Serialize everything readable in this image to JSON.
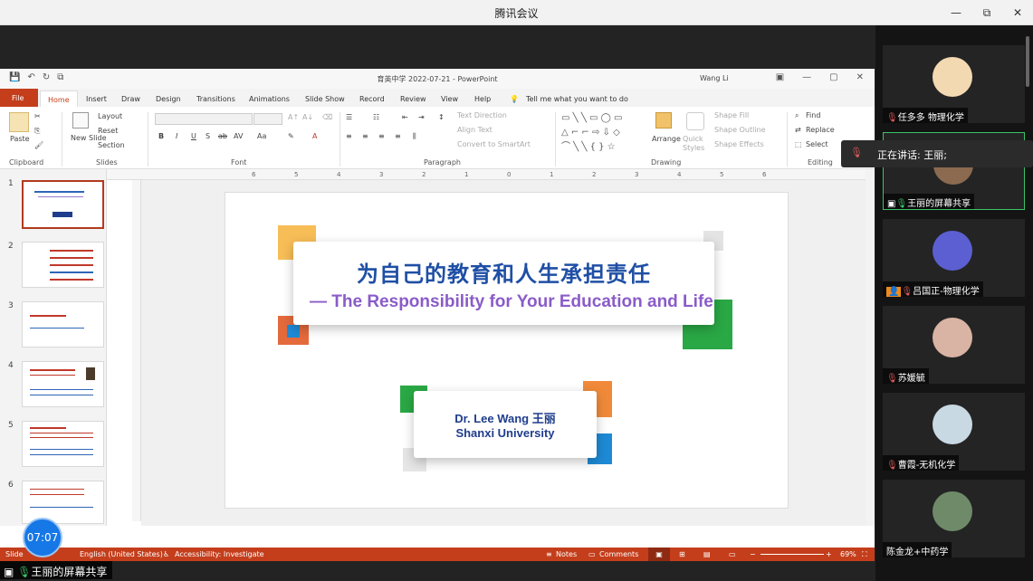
{
  "app_title": "腾讯会议",
  "window_controls": [
    "—",
    "▢",
    "⧉",
    "✕"
  ],
  "ppt": {
    "doc_title": "育英中学 2022-07-21 - PowerPoint",
    "user": "Wang Li",
    "tabs": [
      "File",
      "Home",
      "Insert",
      "Draw",
      "Design",
      "Transitions",
      "Animations",
      "Slide Show",
      "Record",
      "Review",
      "View",
      "Help"
    ],
    "tellme": "Tell me what you want to do",
    "ribbon": {
      "paste": "Paste",
      "new_slide": "New Slide",
      "layout": "Layout",
      "reset": "Reset",
      "section": "Section",
      "text_direction": "Text Direction",
      "align_text": "Align Text",
      "convert_smartart": "Convert to SmartArt",
      "arrange": "Arrange",
      "quick_styles": "Quick Styles",
      "shape_fill": "Shape Fill",
      "shape_outline": "Shape Outline",
      "shape_effects": "Shape Effects",
      "find": "Find",
      "replace": "Replace",
      "select": "Select",
      "groups": {
        "clipboard": "Clipboard",
        "slides": "Slides",
        "font": "Font",
        "paragraph": "Paragraph",
        "drawing": "Drawing",
        "editing": "Editing"
      }
    },
    "ruler_marks": [
      "6",
      "5",
      "4",
      "3",
      "2",
      "1",
      "0",
      "1",
      "2",
      "3",
      "4",
      "5",
      "6"
    ],
    "thumbnails": [
      "1",
      "2",
      "3",
      "4",
      "5",
      "6"
    ],
    "slide": {
      "title_zh": "为自己的教育和人生承担责任",
      "title_en": "— The Responsibility for Your Education and Life",
      "author": "Dr. Lee Wang 王丽",
      "university": "Shanxi University"
    },
    "status": {
      "slide": "Slide",
      "language": "English (United States)",
      "accessibility": "Accessibility: Investigate",
      "notes": "Notes",
      "comments": "Comments",
      "zoom": "69%"
    }
  },
  "timer": "07:07",
  "share_label": "王丽的屏幕共享",
  "speaking": "正在讲话: 王丽;",
  "participants": [
    {
      "name": "任多多 物理化学",
      "avatar": "cartoon-girl-avatar"
    },
    {
      "name": "王丽的屏幕共享",
      "avatar": "share-avatar"
    },
    {
      "name": "吕国正-物理化学",
      "avatar": "anime-avatar"
    },
    {
      "name": "苏媛毓",
      "avatar": "photo-avatar"
    },
    {
      "name": "曹霞-无机化学",
      "avatar": "photo-avatar"
    },
    {
      "name": "陈金龙+中药学",
      "avatar": "landscape-avatar"
    }
  ]
}
